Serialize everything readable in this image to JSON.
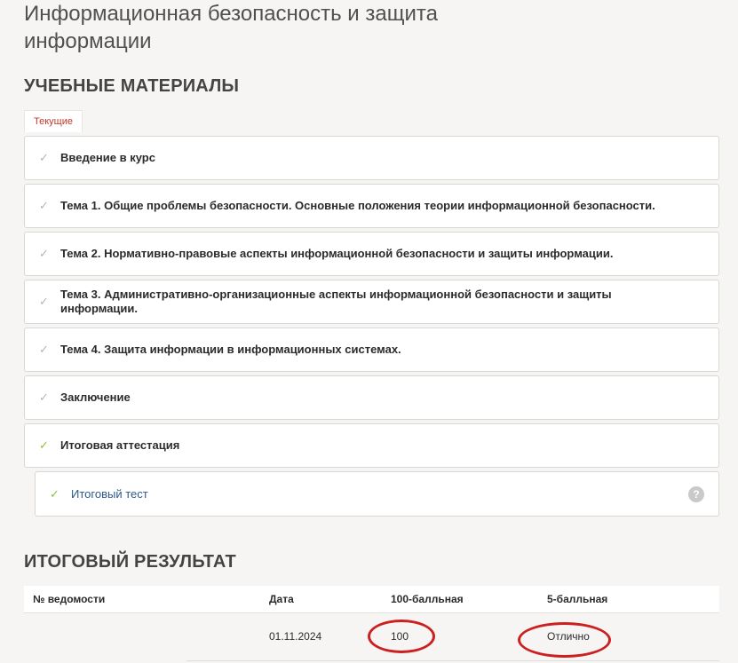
{
  "course": {
    "title": "Информационная безопасность и защита информации"
  },
  "materials": {
    "heading": "УЧЕБНЫЕ МАТЕРИАЛЫ",
    "tab_current": "Текущие",
    "modules": [
      {
        "label": "Введение в курс",
        "done": false
      },
      {
        "label": "Тема 1. Общие проблемы безопасности. Основные положения теории информационной безопасности.",
        "done": false
      },
      {
        "label": "Тема 2. Нормативно-правовые аспекты информационной безопасности и защиты информации.",
        "done": false
      },
      {
        "label": "Тема 3. Административно-организационные аспекты информационной безопасности и защиты информации.",
        "done": false
      },
      {
        "label": "Тема 4. Защита информации в информационных системах.",
        "done": false
      },
      {
        "label": "Заключение",
        "done": false
      },
      {
        "label": "Итоговая аттестация",
        "done": true
      }
    ],
    "submodule": {
      "label": "Итоговый тест",
      "done": true,
      "help_glyph": "?"
    },
    "check_glyph": "✓",
    "colors": {
      "check_done": "#8dbf3a",
      "check_pending": "#b5b5b5",
      "link": "#2c5a8a"
    }
  },
  "result": {
    "heading": "ИТОГОВЫЙ РЕЗУЛЬТАТ",
    "columns": [
      "№ ведомости",
      "Дата",
      "100-балльная",
      "5-балльная"
    ],
    "rows": [
      {
        "sheet_no": "",
        "date": "01.11.2024",
        "score100": "100",
        "score5": "Отлично"
      }
    ],
    "highlight_color": "#cc1f1f"
  }
}
